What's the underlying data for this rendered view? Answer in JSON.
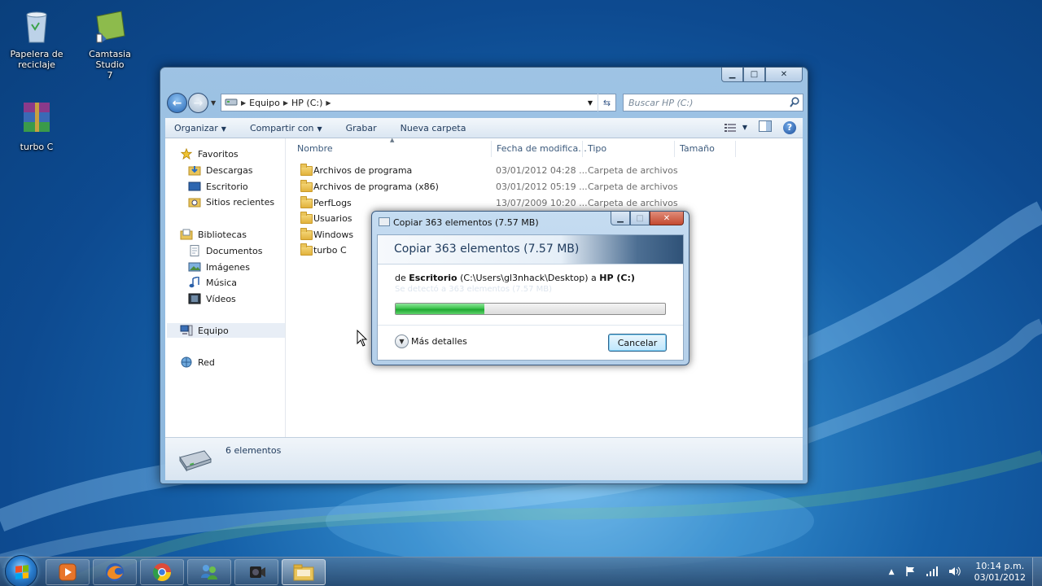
{
  "desktop": {
    "icons": [
      {
        "label_line1": "Papelera de",
        "label_line2": "reciclaje"
      },
      {
        "label_line1": "Camtasia Studio",
        "label_line2": "7"
      },
      {
        "label_line1": "turbo C",
        "label_line2": ""
      }
    ]
  },
  "explorer": {
    "address": {
      "crumbs": [
        "Equipo",
        "HP (C:)"
      ]
    },
    "search_placeholder": "Buscar HP (C:)",
    "toolbar": {
      "organize": "Organizar",
      "share": "Compartir con",
      "burn": "Grabar",
      "new_folder": "Nueva carpeta"
    },
    "nav": {
      "favorites": "Favoritos",
      "favorites_items": [
        "Descargas",
        "Escritorio",
        "Sitios recientes"
      ],
      "libraries": "Bibliotecas",
      "libraries_items": [
        "Documentos",
        "Imágenes",
        "Música",
        "Vídeos"
      ],
      "computer": "Equipo",
      "network": "Red"
    },
    "columns": {
      "name": "Nombre",
      "date": "Fecha de modifica...",
      "type": "Tipo",
      "size": "Tamaño"
    },
    "files": [
      {
        "name": "Archivos de programa",
        "date": "03/01/2012 04:28 ...",
        "type": "Carpeta de archivos"
      },
      {
        "name": "Archivos de programa (x86)",
        "date": "03/01/2012 05:19 ...",
        "type": "Carpeta de archivos"
      },
      {
        "name": "PerfLogs",
        "date": "13/07/2009 10:20 ...",
        "type": "Carpeta de archivos"
      },
      {
        "name": "Usuarios",
        "date": "",
        "type": ""
      },
      {
        "name": "Windows",
        "date": "",
        "type": ""
      },
      {
        "name": "turbo C",
        "date": "",
        "type": ""
      }
    ],
    "status": "6 elementos"
  },
  "copy_dialog": {
    "title": "Copiar 363 elementos (7.57 MB)",
    "heading": "Copiar 363 elementos (7.57 MB)",
    "from_prefix": "de",
    "from_name": "Escritorio",
    "from_path": "(C:\\Users\\gl3nhack\\Desktop)",
    "to_prefix": "a",
    "to_name": "HP (C:)",
    "ghost_text": "Se detectó a 363 elementos (7.57 MB)",
    "progress_percent": 33,
    "more_details": "Más detalles",
    "cancel": "Cancelar"
  },
  "taskbar": {
    "time": "10:14 p.m.",
    "date": "03/01/2012"
  },
  "colors": {
    "accent": "#2566b5",
    "progress": "#1fa731"
  }
}
